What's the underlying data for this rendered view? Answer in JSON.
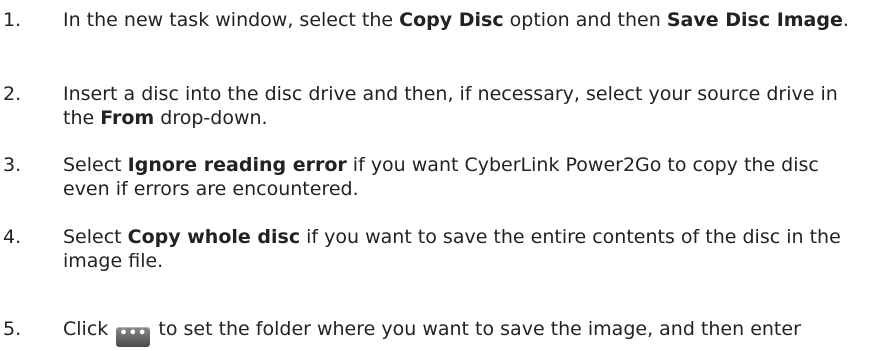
{
  "steps": [
    {
      "number": "1.",
      "parts": [
        "In the new task window, select the ",
        "Copy Disc",
        " option and then ",
        "Save Disc Image",
        "."
      ]
    },
    {
      "number": "2.",
      "parts": [
        "Insert a disc into the disc drive and then, if necessary, select your source drive in the ",
        "From",
        " drop-down."
      ]
    },
    {
      "number": "3.",
      "parts": [
        "Select ",
        "Ignore reading error",
        " if you want CyberLink Power2Go to copy the disc even if errors are encountered."
      ]
    },
    {
      "number": "4.",
      "parts": [
        "Select ",
        "Copy whole disc",
        " if you want to save the entire contents of the disc in the image file."
      ]
    },
    {
      "number": "5.",
      "before": "Click",
      "button_icon": "ellipsis-button-icon",
      "button_glyph": "•••",
      "after": "to set the folder where you want to save the image, and then enter"
    }
  ]
}
